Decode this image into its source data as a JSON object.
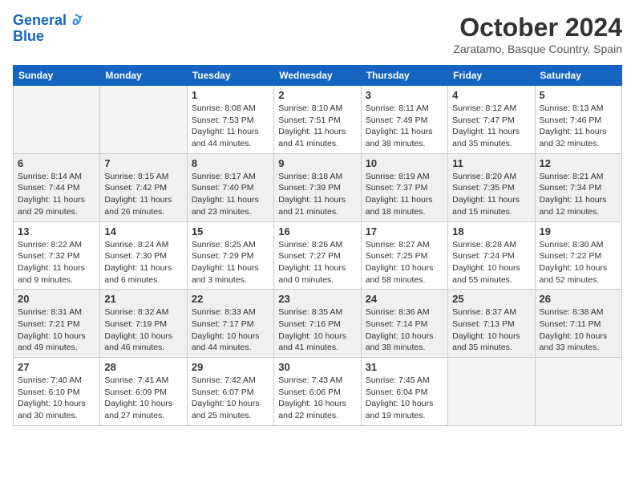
{
  "header": {
    "logo_line1": "General",
    "logo_line2": "Blue",
    "month": "October 2024",
    "location": "Zaratamo, Basque Country, Spain"
  },
  "days_of_week": [
    "Sunday",
    "Monday",
    "Tuesday",
    "Wednesday",
    "Thursday",
    "Friday",
    "Saturday"
  ],
  "weeks": [
    [
      {
        "day": "",
        "text": ""
      },
      {
        "day": "",
        "text": ""
      },
      {
        "day": "1",
        "text": "Sunrise: 8:08 AM\nSunset: 7:53 PM\nDaylight: 11 hours and 44 minutes."
      },
      {
        "day": "2",
        "text": "Sunrise: 8:10 AM\nSunset: 7:51 PM\nDaylight: 11 hours and 41 minutes."
      },
      {
        "day": "3",
        "text": "Sunrise: 8:11 AM\nSunset: 7:49 PM\nDaylight: 11 hours and 38 minutes."
      },
      {
        "day": "4",
        "text": "Sunrise: 8:12 AM\nSunset: 7:47 PM\nDaylight: 11 hours and 35 minutes."
      },
      {
        "day": "5",
        "text": "Sunrise: 8:13 AM\nSunset: 7:46 PM\nDaylight: 11 hours and 32 minutes."
      }
    ],
    [
      {
        "day": "6",
        "text": "Sunrise: 8:14 AM\nSunset: 7:44 PM\nDaylight: 11 hours and 29 minutes."
      },
      {
        "day": "7",
        "text": "Sunrise: 8:15 AM\nSunset: 7:42 PM\nDaylight: 11 hours and 26 minutes."
      },
      {
        "day": "8",
        "text": "Sunrise: 8:17 AM\nSunset: 7:40 PM\nDaylight: 11 hours and 23 minutes."
      },
      {
        "day": "9",
        "text": "Sunrise: 8:18 AM\nSunset: 7:39 PM\nDaylight: 11 hours and 21 minutes."
      },
      {
        "day": "10",
        "text": "Sunrise: 8:19 AM\nSunset: 7:37 PM\nDaylight: 11 hours and 18 minutes."
      },
      {
        "day": "11",
        "text": "Sunrise: 8:20 AM\nSunset: 7:35 PM\nDaylight: 11 hours and 15 minutes."
      },
      {
        "day": "12",
        "text": "Sunrise: 8:21 AM\nSunset: 7:34 PM\nDaylight: 11 hours and 12 minutes."
      }
    ],
    [
      {
        "day": "13",
        "text": "Sunrise: 8:22 AM\nSunset: 7:32 PM\nDaylight: 11 hours and 9 minutes."
      },
      {
        "day": "14",
        "text": "Sunrise: 8:24 AM\nSunset: 7:30 PM\nDaylight: 11 hours and 6 minutes."
      },
      {
        "day": "15",
        "text": "Sunrise: 8:25 AM\nSunset: 7:29 PM\nDaylight: 11 hours and 3 minutes."
      },
      {
        "day": "16",
        "text": "Sunrise: 8:26 AM\nSunset: 7:27 PM\nDaylight: 11 hours and 0 minutes."
      },
      {
        "day": "17",
        "text": "Sunrise: 8:27 AM\nSunset: 7:25 PM\nDaylight: 10 hours and 58 minutes."
      },
      {
        "day": "18",
        "text": "Sunrise: 8:28 AM\nSunset: 7:24 PM\nDaylight: 10 hours and 55 minutes."
      },
      {
        "day": "19",
        "text": "Sunrise: 8:30 AM\nSunset: 7:22 PM\nDaylight: 10 hours and 52 minutes."
      }
    ],
    [
      {
        "day": "20",
        "text": "Sunrise: 8:31 AM\nSunset: 7:21 PM\nDaylight: 10 hours and 49 minutes."
      },
      {
        "day": "21",
        "text": "Sunrise: 8:32 AM\nSunset: 7:19 PM\nDaylight: 10 hours and 46 minutes."
      },
      {
        "day": "22",
        "text": "Sunrise: 8:33 AM\nSunset: 7:17 PM\nDaylight: 10 hours and 44 minutes."
      },
      {
        "day": "23",
        "text": "Sunrise: 8:35 AM\nSunset: 7:16 PM\nDaylight: 10 hours and 41 minutes."
      },
      {
        "day": "24",
        "text": "Sunrise: 8:36 AM\nSunset: 7:14 PM\nDaylight: 10 hours and 38 minutes."
      },
      {
        "day": "25",
        "text": "Sunrise: 8:37 AM\nSunset: 7:13 PM\nDaylight: 10 hours and 35 minutes."
      },
      {
        "day": "26",
        "text": "Sunrise: 8:38 AM\nSunset: 7:11 PM\nDaylight: 10 hours and 33 minutes."
      }
    ],
    [
      {
        "day": "27",
        "text": "Sunrise: 7:40 AM\nSunset: 6:10 PM\nDaylight: 10 hours and 30 minutes."
      },
      {
        "day": "28",
        "text": "Sunrise: 7:41 AM\nSunset: 6:09 PM\nDaylight: 10 hours and 27 minutes."
      },
      {
        "day": "29",
        "text": "Sunrise: 7:42 AM\nSunset: 6:07 PM\nDaylight: 10 hours and 25 minutes."
      },
      {
        "day": "30",
        "text": "Sunrise: 7:43 AM\nSunset: 6:06 PM\nDaylight: 10 hours and 22 minutes."
      },
      {
        "day": "31",
        "text": "Sunrise: 7:45 AM\nSunset: 6:04 PM\nDaylight: 10 hours and 19 minutes."
      },
      {
        "day": "",
        "text": ""
      },
      {
        "day": "",
        "text": ""
      }
    ]
  ]
}
